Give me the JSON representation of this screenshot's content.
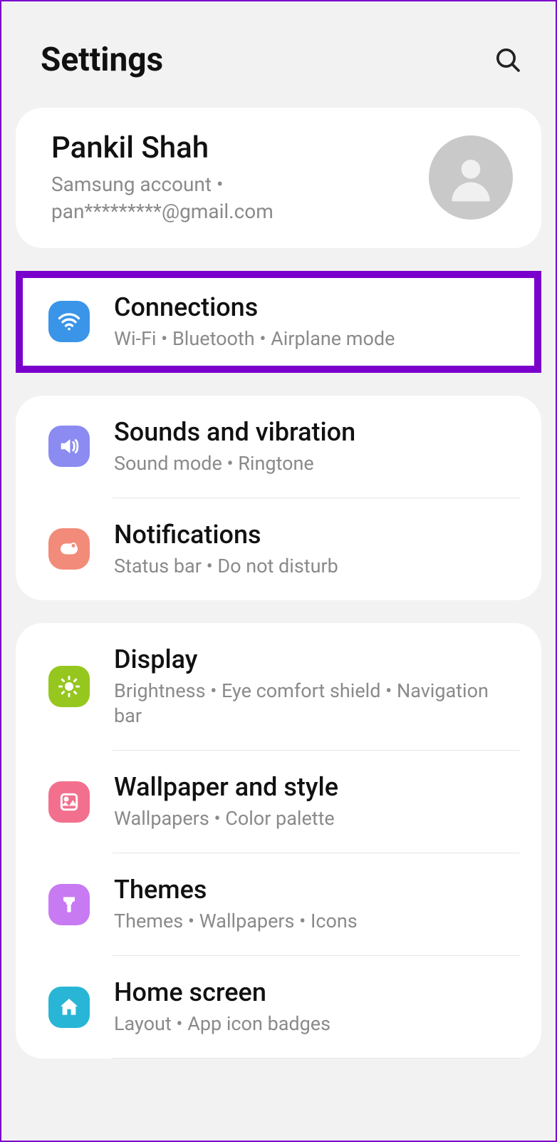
{
  "header": {
    "title": "Settings"
  },
  "account": {
    "name": "Pankil Shah",
    "sub": "Samsung account  •  pan*********@gmail.com"
  },
  "groups": [
    {
      "items": [
        {
          "icon": "wifi",
          "title": "Connections",
          "sub": "Wi-Fi  •  Bluetooth  •  Airplane mode",
          "highlighted": true
        }
      ]
    },
    {
      "items": [
        {
          "icon": "sound",
          "title": "Sounds and vibration",
          "sub": "Sound mode  •  Ringtone"
        },
        {
          "icon": "notif",
          "title": "Notifications",
          "sub": "Status bar  •  Do not disturb"
        }
      ]
    },
    {
      "items": [
        {
          "icon": "display",
          "title": "Display",
          "sub": "Brightness  •  Eye comfort shield  •  Navigation bar"
        },
        {
          "icon": "wallpaper",
          "title": "Wallpaper and style",
          "sub": "Wallpapers  •  Color palette"
        },
        {
          "icon": "themes",
          "title": "Themes",
          "sub": "Themes  •  Wallpapers  •  Icons"
        },
        {
          "icon": "home",
          "title": "Home screen",
          "sub": "Layout  •  App icon badges"
        }
      ]
    }
  ]
}
